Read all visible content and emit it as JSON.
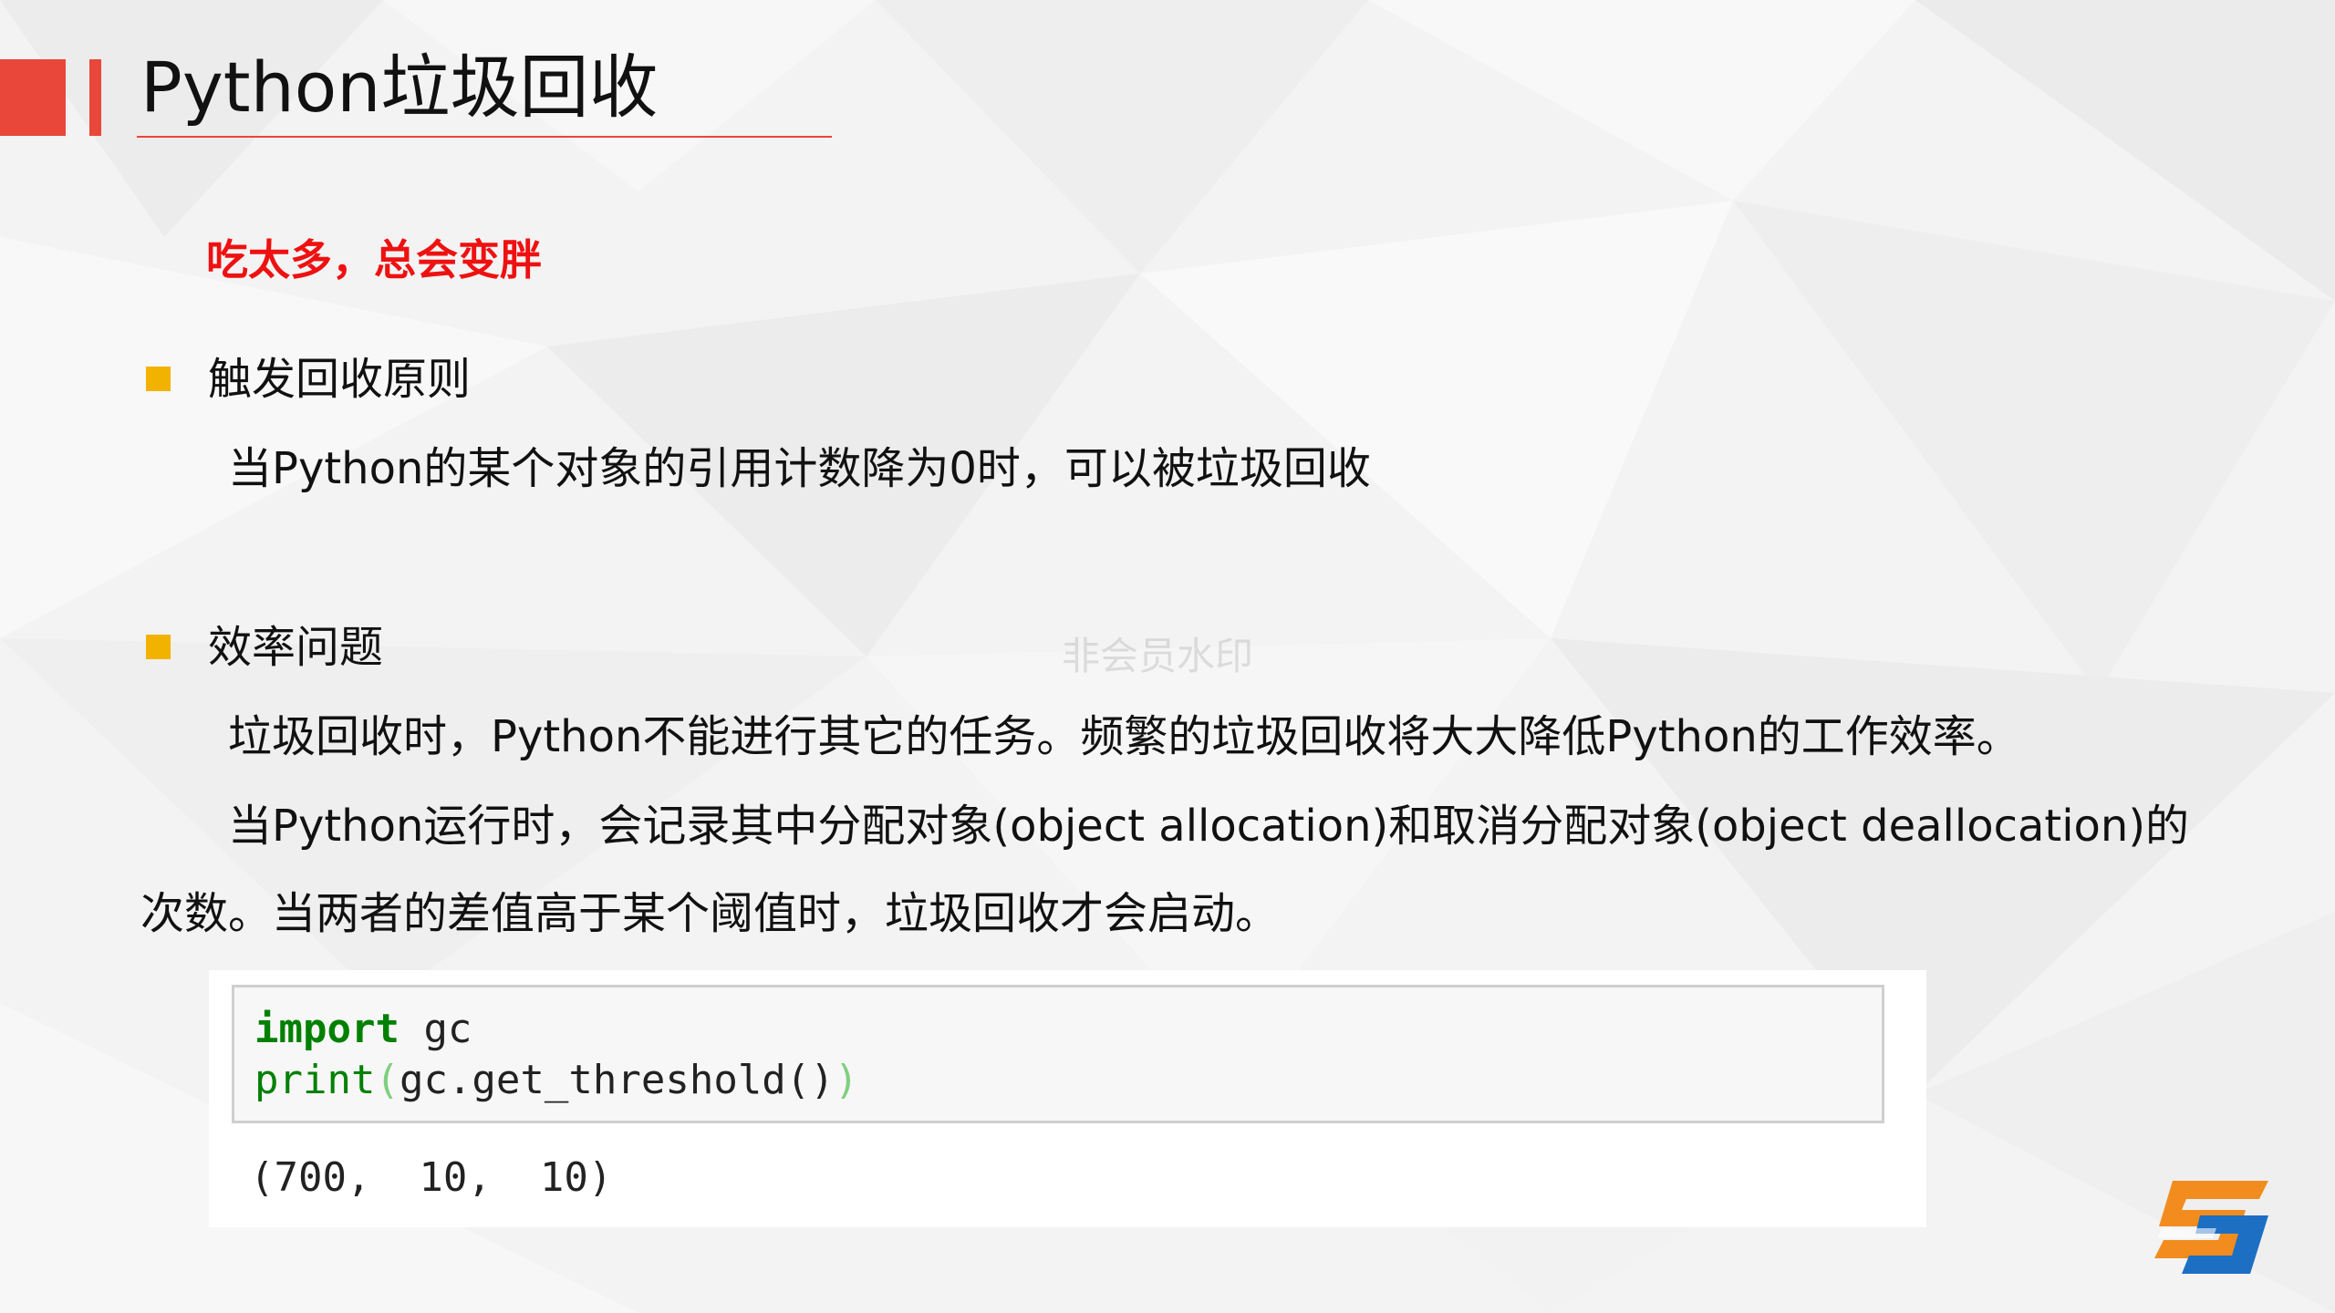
{
  "slide": {
    "title": "Python垃圾回收",
    "subtitle": "吃太多，总会变胖",
    "section1": {
      "heading": "触发回收原则",
      "body": "当Python的某个对象的引用计数降为0时，可以被垃圾回收"
    },
    "section2": {
      "heading": "效率问题",
      "para1": "垃圾回收时，Python不能进行其它的任务。频繁的垃圾回收将大大降低Python的工作效率。",
      "para2_line1": "当Python运行时，会记录其中分配对象(object allocation)和取消分配对象(object deallocation)的",
      "para2_line2": "次数。当两者的差值高于某个阈值时，垃圾回收才会启动。"
    },
    "watermark": "非会员水印",
    "code": {
      "line1_keyword": "import",
      "line1_rest": " gc",
      "line2_func": "print",
      "line2_open": "(",
      "line2_body": "gc.get_threshold",
      "line2_call": "()",
      "line2_close": ")",
      "output": "(700,  10,  10)"
    }
  },
  "colors": {
    "accent_red": "#e8473a",
    "subtitle_red": "#ee1111",
    "bullet_yellow": "#f2b200",
    "code_keyword_green": "#008000",
    "logo_orange": "#f28c1e",
    "logo_blue": "#1d6fc4"
  },
  "icons": {
    "bullet": "square-bullet-icon",
    "logo": "brand-logo-icon"
  }
}
